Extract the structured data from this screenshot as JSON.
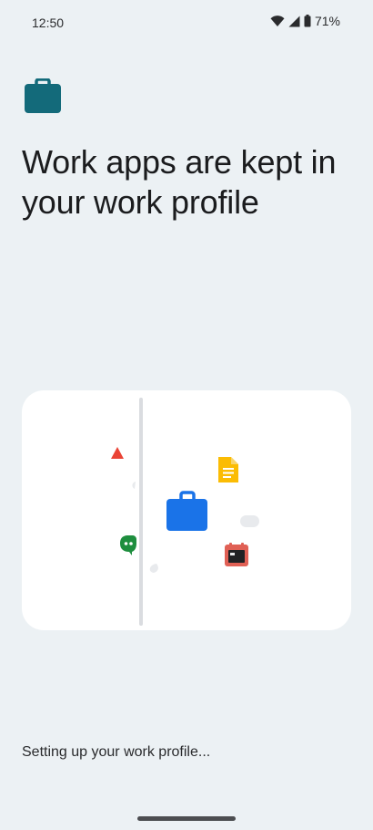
{
  "status_bar": {
    "time": "12:50",
    "battery_percent": "71%",
    "icons": [
      "wifi-icon",
      "cellular-signal-icon",
      "battery-icon"
    ]
  },
  "header": {
    "icon": "briefcase-icon",
    "title": "Work apps are kept in your work profile"
  },
  "illustration": {
    "icons": [
      "triangle-shape-icon",
      "docs-icon",
      "work-briefcase-icon",
      "chat-icon",
      "calendar-icon"
    ]
  },
  "footer": {
    "progress_text": "Setting up your work profile..."
  },
  "colors": {
    "background": "#ecf1f4",
    "header_icon": "#136a7a",
    "briefcase_blue": "#1a73e8",
    "docs_yellow": "#fbbc04",
    "chat_green": "#1e8e3e",
    "calendar_red": "#e06055",
    "triangle_red": "#ea4335"
  }
}
